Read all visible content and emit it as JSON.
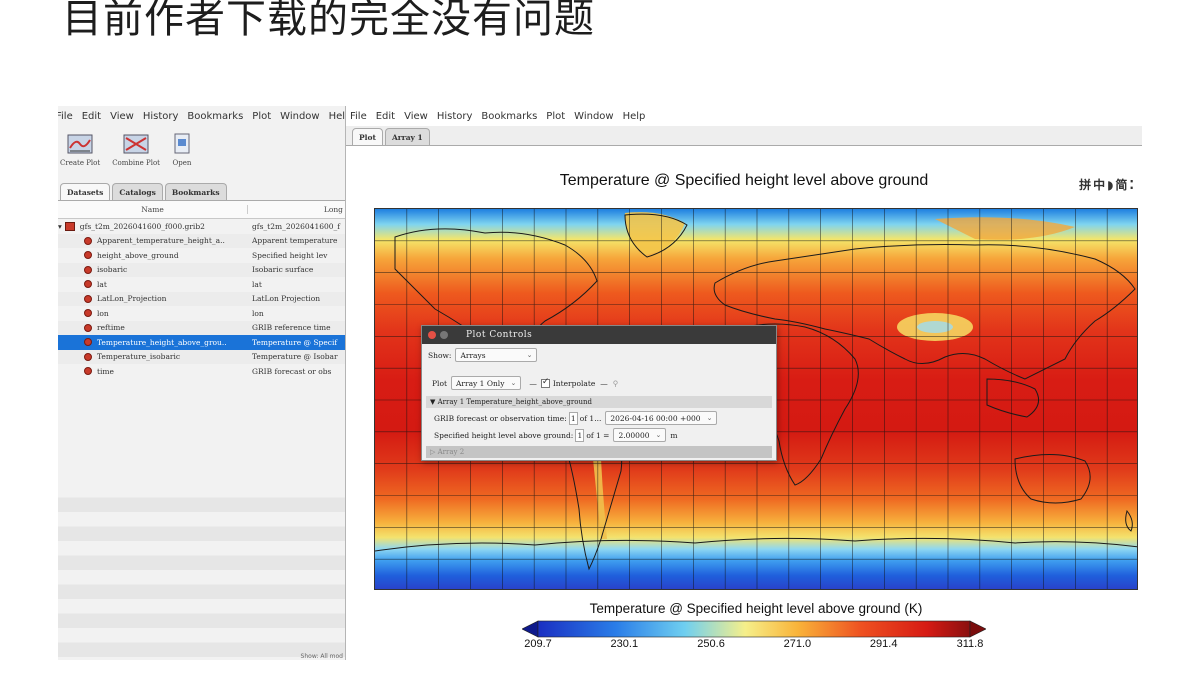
{
  "caption": "目前作者下载的完全没有问题",
  "left_window": {
    "menu": [
      "File",
      "Edit",
      "View",
      "History",
      "Bookmarks",
      "Plot",
      "Window",
      "Help"
    ],
    "toolbar": [
      {
        "label": "Create Plot",
        "icon": "create-plot-icon"
      },
      {
        "label": "Combine Plot",
        "icon": "combine-plot-icon"
      },
      {
        "label": "Open",
        "icon": "open-icon"
      }
    ],
    "tabs": [
      "Datasets",
      "Catalogs",
      "Bookmarks"
    ],
    "columns": {
      "name": "Name",
      "long": "Long"
    },
    "rows": [
      {
        "name": "gfs_t2m_2026041600_f000.grib2",
        "long": "gfs_t2m_2026041600_f",
        "kind": "file"
      },
      {
        "name": "Apparent_temperature_height_a..",
        "long": "Apparent temperature",
        "kind": "var"
      },
      {
        "name": "height_above_ground",
        "long": "Specified height lev",
        "kind": "var"
      },
      {
        "name": "isobaric",
        "long": "Isobaric surface",
        "kind": "var"
      },
      {
        "name": "lat",
        "long": "lat",
        "kind": "var"
      },
      {
        "name": "LatLon_Projection",
        "long": "LatLon Projection",
        "kind": "var"
      },
      {
        "name": "lon",
        "long": "lon",
        "kind": "var"
      },
      {
        "name": "reftime",
        "long": "GRIB reference time",
        "kind": "var"
      },
      {
        "name": "Temperature_height_above_grou..",
        "long": "Temperature @ Specif",
        "kind": "var",
        "selected": true
      },
      {
        "name": "Temperature_isobaric",
        "long": "Temperature @ Isobar",
        "kind": "var"
      },
      {
        "name": "time",
        "long": "GRIB forecast or obs",
        "kind": "var"
      }
    ],
    "status": "Show: All mod"
  },
  "right_window": {
    "menu": [
      "File",
      "Edit",
      "View",
      "History",
      "Bookmarks",
      "Plot",
      "Window",
      "Help"
    ],
    "tabs": [
      "Plot",
      "Array 1"
    ],
    "plot_title": "Temperature @ Specified height level above ground",
    "ime_toolbar": "拼中◗简⁚",
    "colorbar": {
      "title": "Temperature @ Specified height level above ground (K)",
      "ticks": [
        "209.7",
        "230.1",
        "250.6",
        "271.0",
        "291.4",
        "311.8"
      ],
      "min": 209.7,
      "max": 311.8
    }
  },
  "dialog": {
    "title": "Plot Controls",
    "show_label": "Show:",
    "show_value": "Arrays",
    "plot_label": "Plot",
    "plot_value": "Array 1 Only",
    "interpolate_label": "Interpolate",
    "interpolate_checked": true,
    "array1_header": "▼ Array 1   Temperature_height_above_ground",
    "time_label": "GRIB forecast or observation time:",
    "time_index": "1",
    "time_of": "of 1...",
    "time_value": "2026-04-16 00:00 +000",
    "height_label": "Specified height level above ground:",
    "height_index": "1",
    "height_of": "of 1 =",
    "height_value": "2.00000",
    "height_unit": "m",
    "array2_header": "▷ Array 2"
  },
  "colors": {
    "selection": "#1a73d8",
    "dialog_title_bg": "#3a3a3a"
  }
}
